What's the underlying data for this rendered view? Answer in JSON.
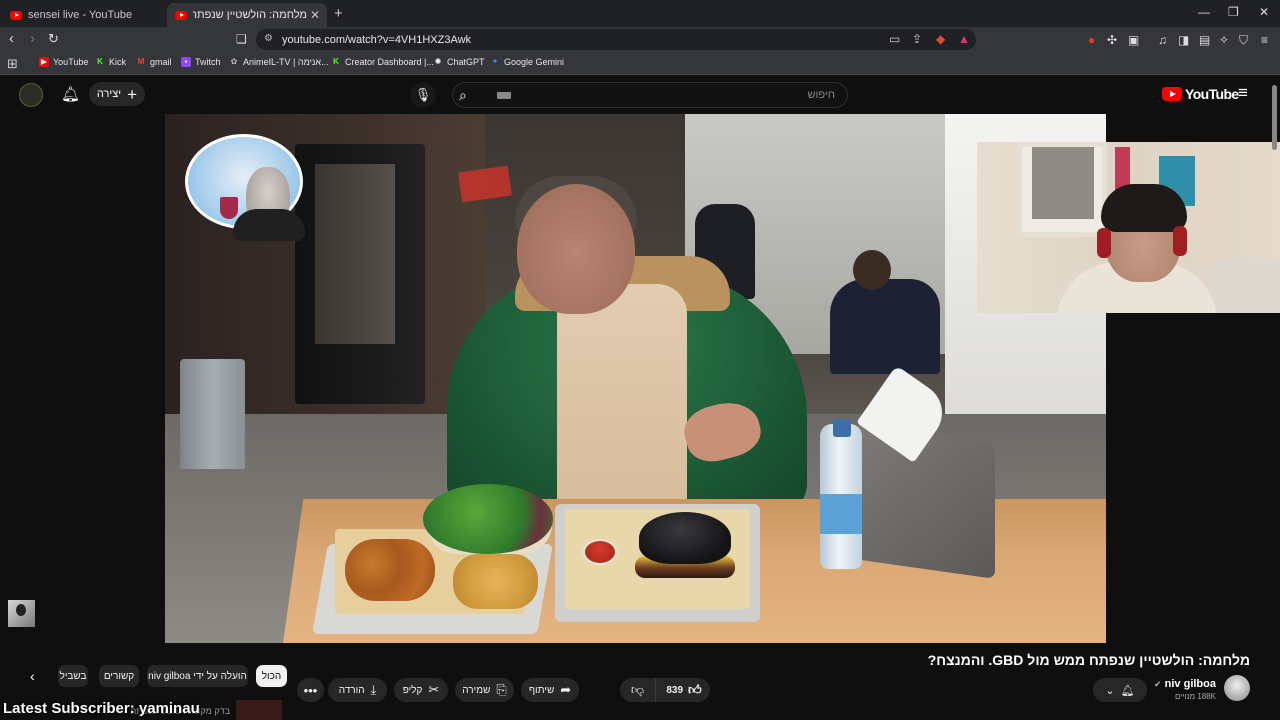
{
  "browser": {
    "tabs": [
      {
        "title": "sensei live - YouTube"
      },
      {
        "title": "מלחמה: הולשטיין שנפתח ממש מ"
      }
    ],
    "url": "youtube.com/watch?v=4VH1HXZ3Awk",
    "bookmarks": [
      {
        "label": "YouTube",
        "icon": "youtube-icon",
        "color": "#ff0000"
      },
      {
        "label": "Kick",
        "icon": "kick-icon",
        "color": "#53fc18"
      },
      {
        "label": "gmail",
        "icon": "gmail-icon",
        "color": "#ea4335"
      },
      {
        "label": "Twitch",
        "icon": "twitch-icon",
        "color": "#9146ff"
      },
      {
        "label": "AnimeIL-TV | אנימה...",
        "icon": "animeil-icon",
        "color": "#888888"
      },
      {
        "label": "Creator Dashboard |...",
        "icon": "kick-icon",
        "color": "#53fc18"
      },
      {
        "label": "ChatGPT",
        "icon": "chatgpt-icon",
        "color": "#ffffff"
      },
      {
        "label": "Google Gemini",
        "icon": "gemini-icon",
        "color": "#4a8cff"
      }
    ]
  },
  "header": {
    "create_label": "יצירה",
    "search_placeholder": "חיפוש",
    "logo_text": "YouTube"
  },
  "video": {
    "title": "מלחמה: הולשטיין שנפתח ממש מול GBD. והמנצח?"
  },
  "chips": [
    {
      "label": "הכול",
      "active": true
    },
    {
      "label": "הועלה על ידי niv gilboa",
      "active": false
    },
    {
      "label": "קשורים",
      "active": false
    },
    {
      "label": "בשביל",
      "active": false
    }
  ],
  "actions": {
    "likes": "839",
    "share": "שיתוף",
    "save": "שמירה",
    "clip": "קליפ",
    "download": "הורדה"
  },
  "channel": {
    "name": "niv gilboa",
    "subscribers": "188K מנויים"
  },
  "overlay": {
    "latest_subscriber": "Latest Subscriber: yaminau",
    "recommended_text": "בדק מקומות שופט שנפתח"
  }
}
